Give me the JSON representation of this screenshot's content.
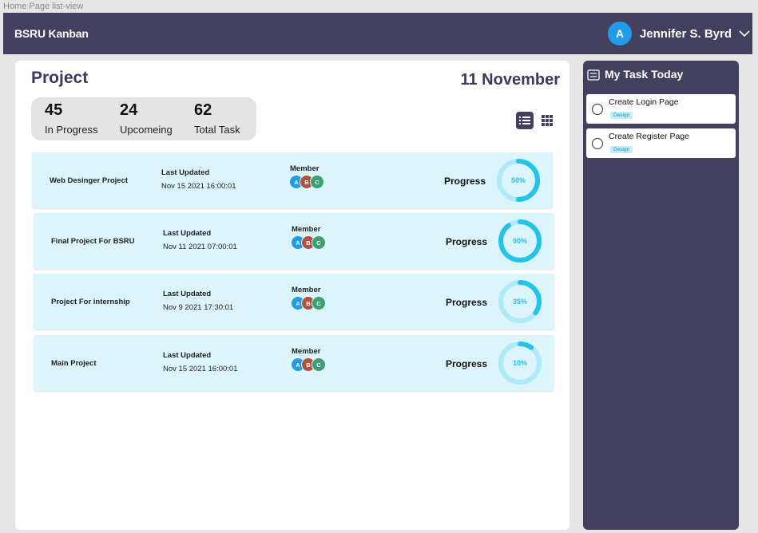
{
  "frame_label": "Home Page list-view",
  "topbar": {
    "brand": "BSRU Kanban",
    "user": {
      "initial": "A",
      "name": "Jennifer S. Byrd"
    }
  },
  "main": {
    "title": "Project",
    "date": "11 November",
    "stats": [
      {
        "value": "45",
        "label": "In Progress"
      },
      {
        "value": "24",
        "label": "Upcomeing"
      },
      {
        "value": "62",
        "label": "Total Task"
      }
    ],
    "columns": {
      "last_updated": "Last Updated",
      "member": "Member",
      "progress": "Progress"
    },
    "projects": [
      {
        "name": "Web Desinger Project",
        "updated": "Nov 15 2021 16:00:01",
        "members": [
          "A",
          "B",
          "C"
        ],
        "progress": 50,
        "progress_label": "50%"
      },
      {
        "name": "Final Project For BSRU",
        "updated": "Nov 11 2021 07:00:01",
        "members": [
          "A",
          "B",
          "C"
        ],
        "progress": 90,
        "progress_label": "90%"
      },
      {
        "name": "Project For internship",
        "updated": "Nov 9 2021 17:30:01",
        "members": [
          "A",
          "B",
          "C"
        ],
        "progress": 35,
        "progress_label": "35%"
      },
      {
        "name": "Main Project",
        "updated": "Nov 15 2021 16:00:01",
        "members": [
          "A",
          "B",
          "C"
        ],
        "progress": 10,
        "progress_label": "10%"
      }
    ]
  },
  "side": {
    "title": "My Task Today",
    "tasks": [
      {
        "title": "Create Login Page",
        "tag": "Design"
      },
      {
        "title": "Create Register Page",
        "tag": "Design"
      }
    ]
  },
  "colors": {
    "topbar": "#42405e",
    "row_bg": "#dcf4fb",
    "ring": "#26c3e8",
    "ring_track": "#aeeaf8",
    "member_colors": [
      "#1f9be8",
      "#b0523f",
      "#3f9e72"
    ]
  },
  "icons": {
    "list_view": "list-view-icon",
    "grid_view": "grid-view-icon",
    "dropdown": "chevron-down-icon",
    "task_list": "task-list-icon"
  }
}
